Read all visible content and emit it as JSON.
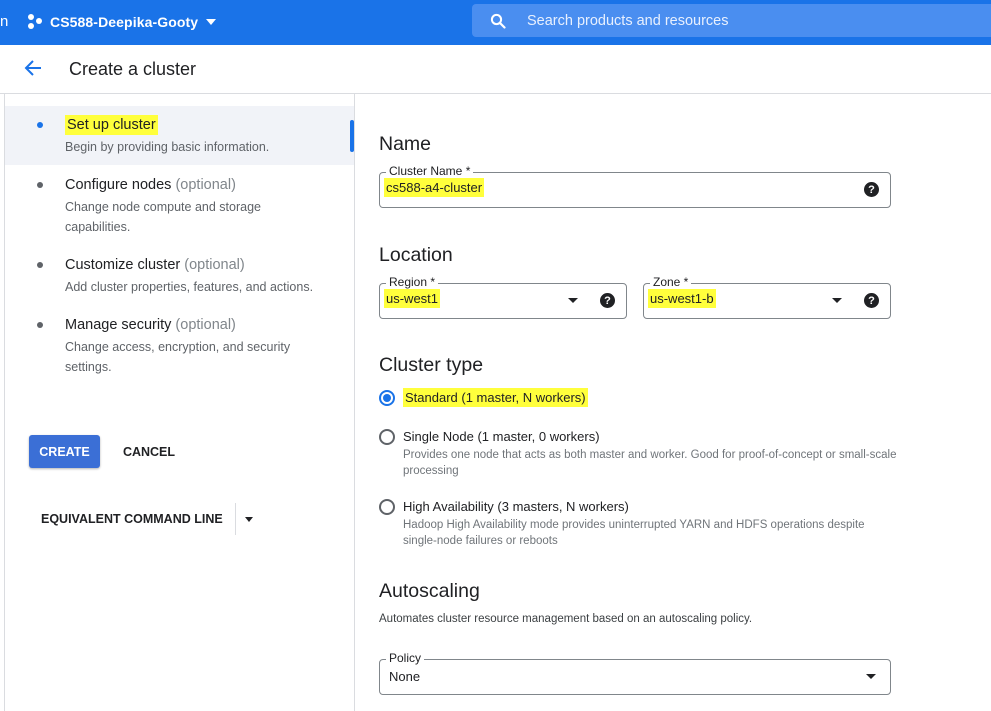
{
  "topbar": {
    "edge_char": "n",
    "project_name": "CS588-Deepika-Gooty",
    "search_placeholder": "Search products and resources",
    "accent_color": "#1a73e8"
  },
  "header": {
    "title": "Create a cluster"
  },
  "steps": [
    {
      "label": "Set up cluster",
      "optional": "",
      "desc": "Begin by providing basic information.",
      "active": true
    },
    {
      "label": "Configure nodes",
      "optional": "(optional)",
      "desc": "Change node compute and storage capabilities."
    },
    {
      "label": "Customize cluster",
      "optional": "(optional)",
      "desc": "Add cluster properties, features, and actions."
    },
    {
      "label": "Manage security",
      "optional": "(optional)",
      "desc": "Change access, encryption, and security settings."
    }
  ],
  "actions": {
    "create": "CREATE",
    "cancel": "CANCEL",
    "command_line": "EQUIVALENT COMMAND LINE"
  },
  "form": {
    "name_section": "Name",
    "cluster_name_label": "Cluster Name *",
    "cluster_name_value": "cs588-a4-cluster",
    "location_section": "Location",
    "region_label": "Region *",
    "region_value": "us-west1",
    "zone_label": "Zone *",
    "zone_value": "us-west1-b",
    "help_glyph": "?",
    "cluster_type_section": "Cluster type",
    "cluster_types": [
      {
        "label": "Standard (1 master, N workers)",
        "desc": "",
        "selected": true
      },
      {
        "label": "Single Node (1 master, 0 workers)",
        "desc": "Provides one node that acts as both master and worker. Good for proof-of-concept or small-scale processing"
      },
      {
        "label": "High Availability (3 masters, N workers)",
        "desc": "Hadoop High Availability mode provides uninterrupted YARN and HDFS operations despite single-node failures or reboots"
      }
    ],
    "autoscaling_section": "Autoscaling",
    "autoscaling_desc": "Automates cluster resource management based on an autoscaling policy.",
    "policy_label": "Policy",
    "policy_value": "None"
  },
  "highlight_color": "#ffff3c"
}
